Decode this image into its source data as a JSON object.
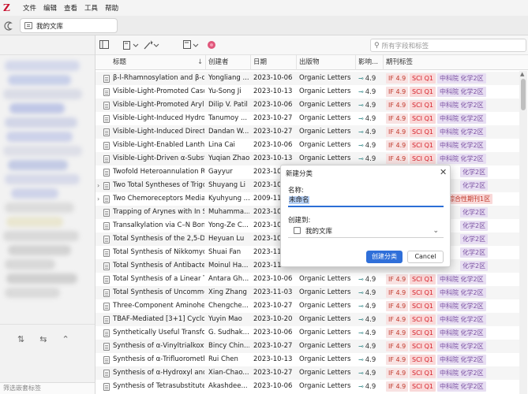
{
  "app": {
    "logo": "Z"
  },
  "menu": [
    "文件",
    "编辑",
    "查看",
    "工具",
    "帮助"
  ],
  "tab": {
    "label": "我的文库"
  },
  "search": {
    "placeholder": "所有字段和标签"
  },
  "sidebar": {
    "tag_filter_placeholder": "筛选嵌套标签"
  },
  "columns": [
    "标题",
    "创建者",
    "日期",
    "出版物",
    "影响...",
    "期刊标签"
  ],
  "rows": [
    {
      "title": "β-l-Rhamnosylation and β-d-",
      "creator": "Yongliang ...",
      "date": "2023-10-06",
      "pub": "Organic Letters",
      "impact": "4.9",
      "if": "IF 4.9",
      "sci": "SCI Q1",
      "cas": "中科院 化学2区",
      "alt": true,
      "twisty": ""
    },
    {
      "title": "Visible-Light-Promoted Casca",
      "creator": "Yu-Song Ji",
      "date": "2023-10-13",
      "pub": "Organic Letters",
      "impact": "4.9",
      "if": "IF 4.9",
      "sci": "SCI Q1",
      "cas": "中科院 化学2区",
      "alt": false,
      "twisty": ""
    },
    {
      "title": "Visible-Light-Promoted Aryl C",
      "creator": "Dilip V. Patil",
      "date": "2023-10-06",
      "pub": "Organic Letters",
      "impact": "4.9",
      "if": "IF 4.9",
      "sci": "SCI Q1",
      "cas": "中科院 化学2区",
      "alt": true,
      "twisty": ""
    },
    {
      "title": "Visible-Light-Induced Hydrog",
      "creator": "Tanumoy ...",
      "date": "2023-10-27",
      "pub": "Organic Letters",
      "impact": "4.9",
      "if": "IF 4.9",
      "sci": "SCI Q1",
      "cas": "中科院 化学2区",
      "alt": false,
      "twisty": ""
    },
    {
      "title": "Visible-Light-Induced Direct F",
      "creator": "Dandan W...",
      "date": "2023-10-27",
      "pub": "Organic Letters",
      "impact": "4.9",
      "if": "IF 4.9",
      "sci": "SCI Q1",
      "cas": "中科院 化学2区",
      "alt": true,
      "twisty": ""
    },
    {
      "title": "Visible-Light-Enabled Lanthar",
      "creator": "Lina Cai",
      "date": "2023-10-06",
      "pub": "Organic Letters",
      "impact": "4.9",
      "if": "IF 4.9",
      "sci": "SCI Q1",
      "cas": "中科院 化学2区",
      "alt": false,
      "twisty": ""
    },
    {
      "title": "Visible-Light-Driven α-Substit",
      "creator": "Yuqian Zhao",
      "date": "2023-10-13",
      "pub": "Organic Letters",
      "impact": "4.9",
      "if": "IF 4.9",
      "sci": "SCI Q1",
      "cas": "中科院 化学2区",
      "alt": true,
      "twisty": ""
    },
    {
      "title": "Twofold Heteroannulation Re",
      "creator": "Gayyur",
      "date": "2023-10-...",
      "pub": "",
      "impact": "",
      "if": "",
      "sci": "",
      "cas": "化学2区",
      "alt": false,
      "twisty": ""
    },
    {
      "title": "Two Total Syntheses of Trigox",
      "creator": "Shuyang Li",
      "date": "2023-10-...",
      "pub": "",
      "impact": "",
      "if": "",
      "sci": "",
      "cas": "化学2区",
      "alt": true,
      "twisty": "›"
    },
    {
      "title": "Two Chemoreceptors Mediate",
      "creator": "Kyuhyung ...",
      "date": "2009-11-...",
      "pub": "",
      "impact": "",
      "if": "",
      "sci": "",
      "cas": "综合性期刊1区",
      "cas_red": "科院",
      "alt": false,
      "twisty": "›"
    },
    {
      "title": "Trapping of Arynes with In Sit",
      "creator": "Muhamma...",
      "date": "2023-10-...",
      "pub": "",
      "impact": "",
      "if": "",
      "sci": "",
      "cas": "化学2区",
      "alt": true,
      "twisty": ""
    },
    {
      "title": "Transalkylation via C–N Bond",
      "creator": "Yong-Ze C...",
      "date": "2023-10-...",
      "pub": "",
      "impact": "",
      "if": "",
      "sci": "",
      "cas": "化学2区",
      "alt": false,
      "twisty": ""
    },
    {
      "title": "Total Synthesis of the 2,5-Disu",
      "creator": "Heyuan Lu",
      "date": "2023-10-...",
      "pub": "",
      "impact": "",
      "if": "",
      "sci": "",
      "cas": "化学2区",
      "alt": true,
      "twisty": ""
    },
    {
      "title": "Total Synthesis of Nikkomycir",
      "creator": "Shuai Fan",
      "date": "2023-11-...",
      "pub": "",
      "impact": "",
      "if": "",
      "sci": "",
      "cas": "化学2区",
      "alt": false,
      "twisty": ""
    },
    {
      "title": "Total Synthesis of Antibacteria",
      "creator": "Moinul Ha...",
      "date": "2023-11-...",
      "pub": "",
      "impact": "",
      "if": "",
      "sci": "",
      "cas": "化学2区",
      "alt": true,
      "twisty": ""
    },
    {
      "title": "Total Synthesis of a Linear Tet",
      "creator": "Antara Gh...",
      "date": "2023-10-06",
      "pub": "Organic Letters",
      "impact": "4.9",
      "if": "IF 4.9",
      "sci": "SCI Q1",
      "cas": "中科院 化学2区",
      "alt": false,
      "twisty": ""
    },
    {
      "title": "Total Synthesis of Uncommon",
      "creator": "Xing Zhang",
      "date": "2023-11-03",
      "pub": "Organic Letters",
      "impact": "4.9",
      "if": "IF 4.9",
      "sci": "SCI Q1",
      "cas": "中科院 化学2区",
      "alt": true,
      "twisty": ""
    },
    {
      "title": "Three-Component Aminohete",
      "creator": "Chengche...",
      "date": "2023-10-27",
      "pub": "Organic Letters",
      "impact": "4.9",
      "if": "IF 4.9",
      "sci": "SCI Q1",
      "cas": "中科院 化学2区",
      "alt": false,
      "twisty": ""
    },
    {
      "title": "TBAF-Mediated [3+1] Cycloac",
      "creator": "Yuyin Mao",
      "date": "2023-10-20",
      "pub": "Organic Letters",
      "impact": "4.9",
      "if": "IF 4.9",
      "sci": "SCI Q1",
      "cas": "中科院 化学2区",
      "alt": true,
      "twisty": ""
    },
    {
      "title": "Synthetically Useful Transforn",
      "creator": "G. Sudhak...",
      "date": "2023-10-06",
      "pub": "Organic Letters",
      "impact": "4.9",
      "if": "IF 4.9",
      "sci": "SCI Q1",
      "cas": "中科院 化学2区",
      "alt": false,
      "twisty": ""
    },
    {
      "title": "Synthesis of α-Vinyltrialkoxys",
      "creator": "Bincy Chin...",
      "date": "2023-10-27",
      "pub": "Organic Letters",
      "impact": "4.9",
      "if": "IF 4.9",
      "sci": "SCI Q1",
      "cas": "中科院 化学2区",
      "alt": true,
      "twisty": ""
    },
    {
      "title": "Synthesis of α-Trifluorometh",
      "creator": "Rui Chen",
      "date": "2023-10-13",
      "pub": "Organic Letters",
      "impact": "4.9",
      "if": "IF 4.9",
      "sci": "SCI Q1",
      "cas": "中科院 化学2区",
      "alt": false,
      "twisty": ""
    },
    {
      "title": "Synthesis of α-Hydroxyl and c",
      "creator": "Xian-Chao...",
      "date": "2023-10-27",
      "pub": "Organic Letters",
      "impact": "4.9",
      "if": "IF 4.9",
      "sci": "SCI Q1",
      "cas": "中科院 化学2区",
      "alt": true,
      "twisty": ""
    },
    {
      "title": "Synthesis of Tetrasubstituted",
      "creator": "Akashdee...",
      "date": "2023-10-06",
      "pub": "Organic Letters",
      "impact": "4.9",
      "if": "IF 4.9",
      "sci": "SCI Q1",
      "cas": "中科院 化学2区",
      "alt": false,
      "twisty": ""
    }
  ],
  "dialog": {
    "title": "新建分类",
    "name_label": "名称:",
    "name_value": "未命名",
    "parent_label": "创建到:",
    "parent_value": "我的文库",
    "ok_label": "创建分类",
    "cancel_label": "Cancel"
  },
  "colors": {
    "accent": "#2f6fd9",
    "if_badge": "#c0392b",
    "sci_badge": "#d6202a",
    "cas_badge": "#7a4fa1"
  },
  "icons": [
    "history-icon",
    "library-icon",
    "collection-pane-icon",
    "new-item-icon",
    "wand-icon",
    "note-icon",
    "annotation-icon",
    "search-icon"
  ]
}
